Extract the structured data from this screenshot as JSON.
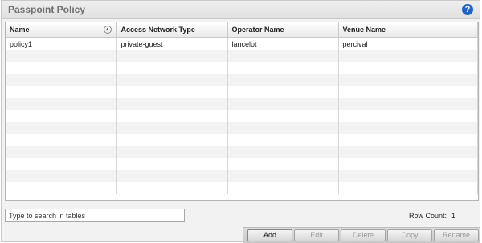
{
  "panel": {
    "title": "Passpoint Policy",
    "help_glyph": "?"
  },
  "table": {
    "headers": [
      "Name",
      "Access Network Type",
      "Operator Name",
      "Venue Name"
    ],
    "rows": [
      [
        "policy1",
        "private-guest",
        "lancelot",
        "percival"
      ]
    ],
    "sort_glyph": "▴"
  },
  "footer": {
    "search_placeholder": "Type to search in tables",
    "row_count_label": "Row Count:",
    "row_count_value": "1"
  },
  "buttons": {
    "add": "Add",
    "edit": "Edit",
    "delete": "Delete",
    "copy": "Copy",
    "rename": "Rename"
  },
  "colors": {
    "help_icon": "#1f63c8",
    "panel_bg": "#f2f2f2",
    "grid_border": "#b5b5b5"
  }
}
